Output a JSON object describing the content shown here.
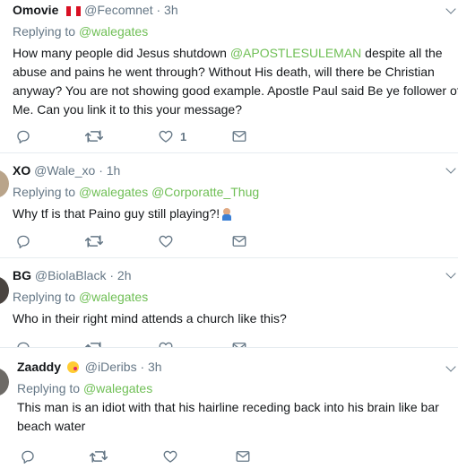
{
  "tweets": [
    {
      "name": "Omovie",
      "handle": "@Fecomnet",
      "time": "· 3h",
      "replying_prefix": "Replying to",
      "replying_to": "@walegates",
      "text_before": "How many people did Jesus shutdown ",
      "text_mention": "@APOSTLESULEMAN",
      "text_after": " despite all the abuse and pains he went through? Without His death, will there be Christian anyway? You are not showing good example.  Apostle Paul said Be ye follower of Me. Can you link it to this your message?",
      "like_count": "1"
    },
    {
      "name": "XO",
      "handle": "@Wale_xo",
      "time": "· 1h",
      "replying_prefix": "Replying to",
      "replying_to": "@walegates",
      "replying_to_2": "@Corporatte_Thug",
      "text": "Why tf is that Paino guy still playing?!"
    },
    {
      "name": "BG",
      "handle": "@BiolaBlack",
      "time": "· 2h",
      "replying_prefix": "Replying to",
      "replying_to": "@walegates",
      "text": "Who in their right mind attends a church like this?"
    },
    {
      "name": "Zaaddy",
      "handle": "@iDeribs",
      "time": "· 3h",
      "replying_prefix": "Replying to",
      "replying_to": "@walegates",
      "text": "This man is an idiot with that his hairline receding back into his brain like bar beach water"
    }
  ],
  "icons": {
    "reply": "reply-icon",
    "retweet": "retweet-icon",
    "like": "heart-icon",
    "message": "envelope-icon",
    "more": "chevron-down-icon"
  },
  "colors": {
    "mention": "#6fbf55",
    "secondary_text": "#657786",
    "divider": "#e6ecf0"
  }
}
